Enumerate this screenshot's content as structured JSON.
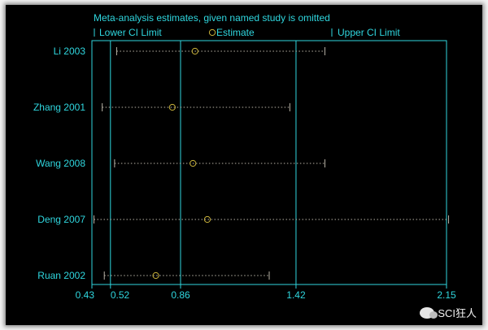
{
  "chart_data": {
    "type": "forest",
    "title": "Meta-analysis estimates, given named study is omitted",
    "legend": {
      "lower": "Lower CI Limit",
      "estimate": "Estimate",
      "upper": "Upper CI Limit"
    },
    "x_ticks": [
      {
        "value": 0.43,
        "label": "0.43"
      },
      {
        "value": 0.52,
        "label": "0.52"
      },
      {
        "value": 0.86,
        "label": "0.86"
      },
      {
        "value": 1.42,
        "label": "1.42"
      },
      {
        "value": 2.15,
        "label": "2.15"
      }
    ],
    "xlim": [
      0.43,
      2.15
    ],
    "reference_lines": [
      0.52,
      0.86,
      1.42
    ],
    "studies": [
      {
        "name": "Li 2003",
        "lower": 0.55,
        "estimate": 0.93,
        "upper": 1.56
      },
      {
        "name": "Zhang 2001",
        "lower": 0.48,
        "estimate": 0.82,
        "upper": 1.39
      },
      {
        "name": "Wang 2008",
        "lower": 0.54,
        "estimate": 0.92,
        "upper": 1.56
      },
      {
        "name": "Deng 2007",
        "lower": 0.44,
        "estimate": 0.99,
        "upper": 2.16
      },
      {
        "name": "Ruan 2002",
        "lower": 0.49,
        "estimate": 0.74,
        "upper": 1.29
      }
    ],
    "colors": {
      "background": "#000000",
      "text": "#2fd6de",
      "axis": "#2fd6de",
      "ci": "#b8b3a6",
      "estimate": "#c9b23a"
    }
  },
  "watermark": {
    "text": "SCI狂人"
  }
}
